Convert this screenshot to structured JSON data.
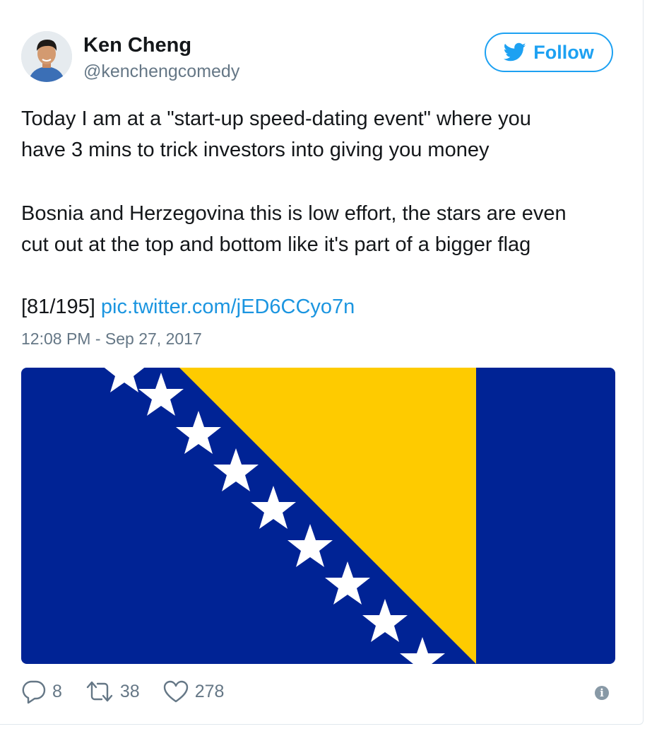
{
  "author": {
    "name": "Ken Cheng",
    "handle": "@kenchengcomedy",
    "avatar_icon": "profile-photo-icon"
  },
  "follow_button": {
    "label": "Follow",
    "icon": "twitter-bird-icon",
    "color": "#1da1f2"
  },
  "tweet": {
    "line1": "Today I am at a \"start-up speed-dating event\" where you",
    "line2": "have 3 mins to trick investors into giving you money",
    "line3": "Bosnia and Herzegovina this is low effort, the stars are even",
    "line4": "cut out at the top and bottom like it's part of a bigger flag",
    "counter": "[81/195]",
    "link": "pic.twitter.com/jED6CCyo7n",
    "timestamp": "12:08 PM - Sep 27, 2017"
  },
  "media": {
    "description_icon": "bosnia-herzegovina-flag",
    "colors": {
      "blue": "#002395",
      "yellow": "#fecb00",
      "star": "#ffffff"
    }
  },
  "actions": {
    "replies": "8",
    "retweets": "38",
    "likes": "278",
    "info_icon": "info-icon"
  }
}
